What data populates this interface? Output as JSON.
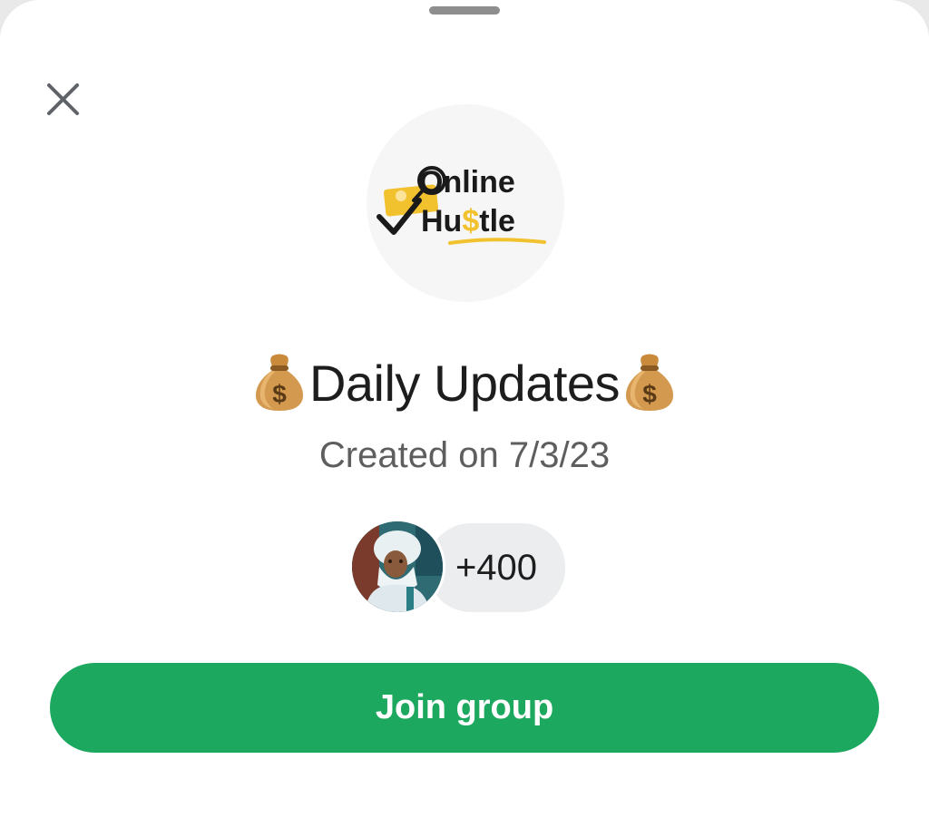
{
  "sheet": {
    "close_icon": "close-icon",
    "group_avatar": {
      "line1": "Online",
      "line2_prefix": "Hu",
      "line2_dollar": "$",
      "line2_suffix": "tle"
    },
    "title_emoji": "money-bag-emoji",
    "title": "Daily Updates",
    "created": "Created on 7/3/23",
    "members": {
      "avatar_icon": "member-avatar",
      "count": "+400"
    },
    "join_label": "Join group"
  },
  "colors": {
    "accent": "#1da85f",
    "title": "#1d1d1d",
    "subtitle": "#5e5e5e",
    "pill": "#ebedee",
    "logo_yellow": "#f2c12e"
  }
}
